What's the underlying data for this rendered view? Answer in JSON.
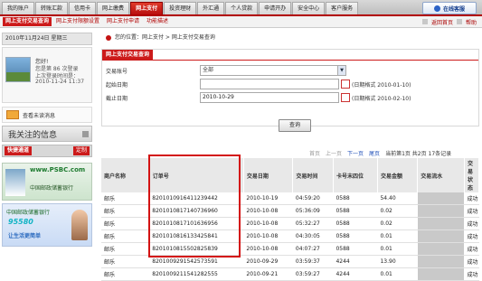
{
  "nav": {
    "tabs": [
      "我的账户",
      "转账汇款",
      "信用卡",
      "网上缴费",
      "网上支付",
      "投资理财",
      "外汇通",
      "个人贷款",
      "申请开办",
      "安全中心",
      "客户服务"
    ],
    "active_tab": "网上支付",
    "logout_label": "在线客服"
  },
  "subnav": {
    "items": [
      "网上支付交易查询",
      "网上支付限额设置",
      "网上支付申请",
      "功能描述"
    ],
    "links": [
      "返回首页",
      "帮助"
    ]
  },
  "sidebar": {
    "date": "2010年11月24日 星期三",
    "greeting": "您好!",
    "login_info": "您是第 86 次登录",
    "last_login_label": "上次登录时间是：",
    "last_login_time": "2010-11-24 11:37",
    "mail_label": "查看未读消息",
    "fav_label": "我关注的信息",
    "quick_label": "快捷通道",
    "custom_label": "定制",
    "banner1_brand": "www.PSBC.com",
    "banner1_text": "中国邮政储蓄银行",
    "banner2_text": "中国邮政储蓄银行",
    "banner2_number": "95580",
    "banner2_tagline": "让生活更简单"
  },
  "breadcrumb": {
    "prefix": "您的位置：",
    "path": "网上支付 > 网上支付交易查询"
  },
  "query": {
    "panel_title": "网上支付交易查询",
    "account_label": "交易账号",
    "account_value": "全部",
    "start_label": "起始日期",
    "start_value": "",
    "start_hint": "(日期格式 2010-01-10)",
    "end_label": "截止日期",
    "end_value": "2010-10-29",
    "end_hint": "(日期格式 2010-02-10)",
    "button_label": "查询"
  },
  "pager": {
    "first": "首页",
    "prev": "上一页",
    "next": "下一页",
    "last": "尾页",
    "info": "当前第1页 共2页 17条记录"
  },
  "table": {
    "headers": [
      "商户名称",
      "订单号",
      "交易日期",
      "交易时间",
      "卡号末四位",
      "交易金额",
      "交易流水",
      "交易状态"
    ],
    "rows": [
      [
        "邮乐",
        "8201010916411239442",
        "2010-10-19",
        "04:59:20",
        "0588",
        "54.40",
        "",
        "成功"
      ],
      [
        "邮乐",
        "8201010817140736960",
        "2010-10-08",
        "05:36:09",
        "0588",
        "0.02",
        "",
        "成功"
      ],
      [
        "邮乐",
        "8201010817101636956",
        "2010-10-08",
        "05:32:27",
        "0588",
        "0.02",
        "",
        "成功"
      ],
      [
        "邮乐",
        "8201010816133425841",
        "2010-10-08",
        "04:30:05",
        "0588",
        "0.01",
        "",
        "成功"
      ],
      [
        "邮乐",
        "8201010815502825839",
        "2010-10-08",
        "04:07:27",
        "0588",
        "0.01",
        "",
        "成功"
      ],
      [
        "邮乐",
        "8201009291542573591",
        "2010-09-29",
        "03:59:37",
        "4244",
        "13.90",
        "",
        "成功"
      ],
      [
        "邮乐",
        "8201009211541282555",
        "2010-09-21",
        "03:59:27",
        "4244",
        "0.01",
        "",
        "成功"
      ]
    ]
  },
  "colors": {
    "brand_red": "#cc1a1a",
    "highlight": "#d31212"
  }
}
